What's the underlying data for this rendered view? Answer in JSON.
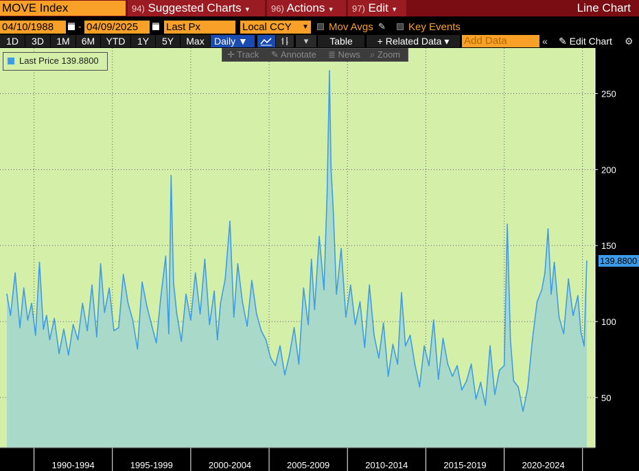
{
  "header": {
    "ticker": "MOVE Index",
    "menus": [
      {
        "num": "94)",
        "label": "Suggested Charts"
      },
      {
        "num": "96)",
        "label": "Actions"
      },
      {
        "num": "97)",
        "label": "Edit"
      }
    ],
    "chart_type": "Line Chart"
  },
  "controls": {
    "start_date": "04/10/1988",
    "end_date": "04/09/2025",
    "separator": "-",
    "field": "Last Px",
    "currency": "Local CCY",
    "mov_avgs": "Mov Avgs",
    "key_events": "Key Events"
  },
  "toolbar": {
    "ranges": [
      "1D",
      "3D",
      "1M",
      "6M",
      "YTD",
      "1Y",
      "5Y",
      "Max"
    ],
    "frequency": "Daily",
    "table": "Table",
    "related_data": "Related Data",
    "add_data_placeholder": "Add Data",
    "edit_chart": "Edit Chart"
  },
  "float_toolbar": [
    "Track",
    "Annotate",
    "News",
    "Zoom"
  ],
  "legend": {
    "label": "Last Price",
    "value": "139.8800"
  },
  "colors": {
    "line": "#3d9be9",
    "plot_bg": "#d4f0a8",
    "area_fill": "#a9d9c8",
    "accent": "#f8a028",
    "header_bg": "#7a0c14"
  },
  "chart_data": {
    "type": "area",
    "title": "",
    "series": [
      {
        "name": "Last Price"
      }
    ],
    "x": [
      1988.27,
      1988.5,
      1988.8,
      1989.1,
      1989.35,
      1989.6,
      1989.85,
      1990.1,
      1990.35,
      1990.6,
      1990.8,
      1991.0,
      1991.3,
      1991.6,
      1991.9,
      1992.2,
      1992.5,
      1992.8,
      1993.1,
      1993.4,
      1993.7,
      1994.0,
      1994.25,
      1994.5,
      1994.8,
      1995.1,
      1995.4,
      1995.7,
      1996.0,
      1996.3,
      1996.6,
      1996.9,
      1997.2,
      1997.5,
      1997.8,
      1998.1,
      1998.4,
      1998.6,
      1998.75,
      1998.9,
      1999.1,
      1999.4,
      1999.7,
      2000.0,
      2000.3,
      2000.6,
      2000.9,
      2001.2,
      2001.5,
      2001.7,
      2001.9,
      2002.2,
      2002.5,
      2002.75,
      2003.0,
      2003.3,
      2003.6,
      2003.9,
      2004.2,
      2004.5,
      2004.8,
      2005.1,
      2005.4,
      2005.7,
      2006.0,
      2006.3,
      2006.6,
      2006.9,
      2007.2,
      2007.5,
      2007.7,
      2007.9,
      2008.2,
      2008.5,
      2008.7,
      2008.85,
      2008.95,
      2009.1,
      2009.3,
      2009.6,
      2009.9,
      2010.2,
      2010.5,
      2010.8,
      2011.1,
      2011.4,
      2011.7,
      2012.0,
      2012.3,
      2012.6,
      2012.9,
      2013.2,
      2013.45,
      2013.7,
      2014.0,
      2014.3,
      2014.6,
      2014.9,
      2015.2,
      2015.5,
      2015.8,
      2016.1,
      2016.4,
      2016.7,
      2017.0,
      2017.3,
      2017.6,
      2017.9,
      2018.2,
      2018.5,
      2018.8,
      2019.1,
      2019.4,
      2019.7,
      2020.0,
      2020.2,
      2020.4,
      2020.6,
      2020.9,
      2021.2,
      2021.5,
      2021.8,
      2022.1,
      2022.4,
      2022.6,
      2022.8,
      2023.0,
      2023.2,
      2023.5,
      2023.8,
      2024.1,
      2024.4,
      2024.7,
      2024.9,
      2025.1,
      2025.27
    ],
    "values": [
      118,
      104,
      132,
      96,
      122,
      101,
      112,
      91,
      139,
      95,
      104,
      88,
      102,
      79,
      95,
      78,
      98,
      88,
      112,
      94,
      124,
      90,
      138,
      106,
      122,
      94,
      96,
      131,
      112,
      101,
      82,
      126,
      110,
      98,
      86,
      117,
      143,
      92,
      196,
      126,
      106,
      87,
      118,
      101,
      132,
      105,
      141,
      98,
      120,
      88,
      112,
      128,
      166,
      103,
      138,
      113,
      97,
      127,
      105,
      94,
      88,
      76,
      71,
      84,
      65,
      78,
      96,
      72,
      122,
      98,
      141,
      108,
      156,
      121,
      183,
      265,
      201,
      172,
      118,
      148,
      103,
      124,
      98,
      113,
      83,
      124,
      91,
      76,
      99,
      64,
      85,
      72,
      119,
      84,
      91,
      72,
      57,
      84,
      71,
      101,
      62,
      89,
      72,
      64,
      71,
      55,
      61,
      72,
      49,
      60,
      45,
      84,
      52,
      68,
      71,
      164,
      88,
      61,
      57,
      41,
      56,
      88,
      113,
      121,
      132,
      161,
      118,
      139,
      103,
      92,
      128,
      104,
      117,
      93,
      84,
      139.88
    ],
    "ylim": [
      17,
      280
    ],
    "yticks": [
      50,
      100,
      150,
      200,
      250
    ],
    "xlim": [
      1987.83,
      2025.8
    ],
    "x_ticks": [
      1990.0,
      1995.0,
      2000.0,
      2005.0,
      2010.0,
      2015.0,
      2020.0,
      2025.0
    ],
    "x_categories": [
      "1990-1994",
      "1995-1999",
      "2000-2004",
      "2005-2009",
      "2010-2014",
      "2015-2019",
      "2020-2024"
    ],
    "x_category_centers": [
      1992.5,
      1997.5,
      2002.5,
      2007.5,
      2012.5,
      2017.5,
      2022.5
    ],
    "last_value": "139.8800",
    "grid": true,
    "legend": "top-left"
  }
}
